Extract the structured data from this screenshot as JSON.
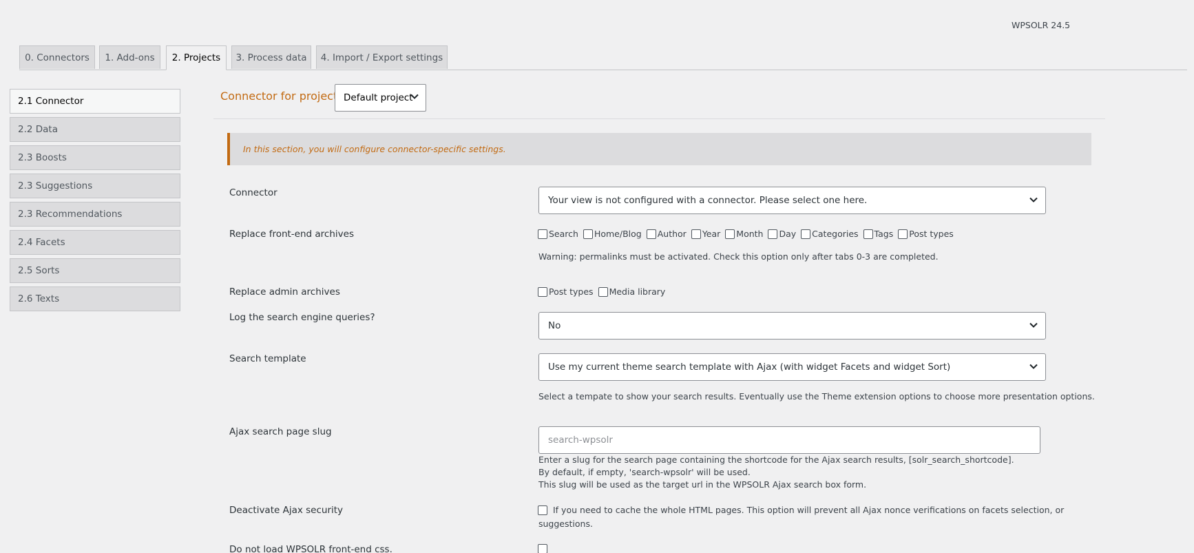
{
  "version": "WPSOLR 24.5",
  "tabs": [
    {
      "label": "0. Connectors"
    },
    {
      "label": "1. Add-ons"
    },
    {
      "label": "2. Projects"
    },
    {
      "label": "3. Process data"
    },
    {
      "label": "4. Import / Export settings"
    }
  ],
  "sidebar": {
    "items": [
      {
        "label": "2.1 Connector"
      },
      {
        "label": "2.2 Data"
      },
      {
        "label": "2.3 Boosts"
      },
      {
        "label": "2.3 Suggestions"
      },
      {
        "label": "2.3 Recommendations"
      },
      {
        "label": "2.4 Facets"
      },
      {
        "label": "2.5 Sorts"
      },
      {
        "label": "2.6 Texts"
      }
    ]
  },
  "project": {
    "label": "Connector for project:",
    "selected": "Default project"
  },
  "notice": "In this section, you will configure connector-specific settings.",
  "form": {
    "connector": {
      "label": "Connector",
      "value": "Your view is not configured with a connector. Please select one here."
    },
    "frontend_archives": {
      "label": "Replace front-end archives",
      "options": [
        "Search",
        "Home/Blog",
        "Author",
        "Year",
        "Month",
        "Day",
        "Categories",
        "Tags",
        "Post types"
      ],
      "warning": "Warning: permalinks must be activated. Check this option only after tabs 0-3 are completed."
    },
    "admin_archives": {
      "label": "Replace admin archives",
      "options": [
        "Post types",
        "Media library"
      ]
    },
    "log_queries": {
      "label": "Log the search engine queries?",
      "value": "No"
    },
    "search_template": {
      "label": "Search template",
      "value": "Use my current theme search template with Ajax (with widget Facets and widget Sort)",
      "help": "Select a tempate to show your search results. Eventually use the Theme extension options to choose more presentation options."
    },
    "ajax_slug": {
      "label": "Ajax search page slug",
      "placeholder": "search-wpsolr",
      "help1": "Enter a slug for the search page containing the shortcode for the Ajax search results, [solr_search_shortcode].",
      "help2": "By default, if empty, 'search-wpsolr' will be used.",
      "help3": "This slug will be used as the target url in the WPSOLR Ajax search box form."
    },
    "ajax_security": {
      "label": "Deactivate Ajax security",
      "help_line1": "If you need to cache the whole HTML pages. This option will prevent all Ajax nonce verifications on facets selection, or",
      "help_line2": "suggestions."
    },
    "no_css": {
      "label": "Do not load WPSOLR front-end css."
    }
  }
}
